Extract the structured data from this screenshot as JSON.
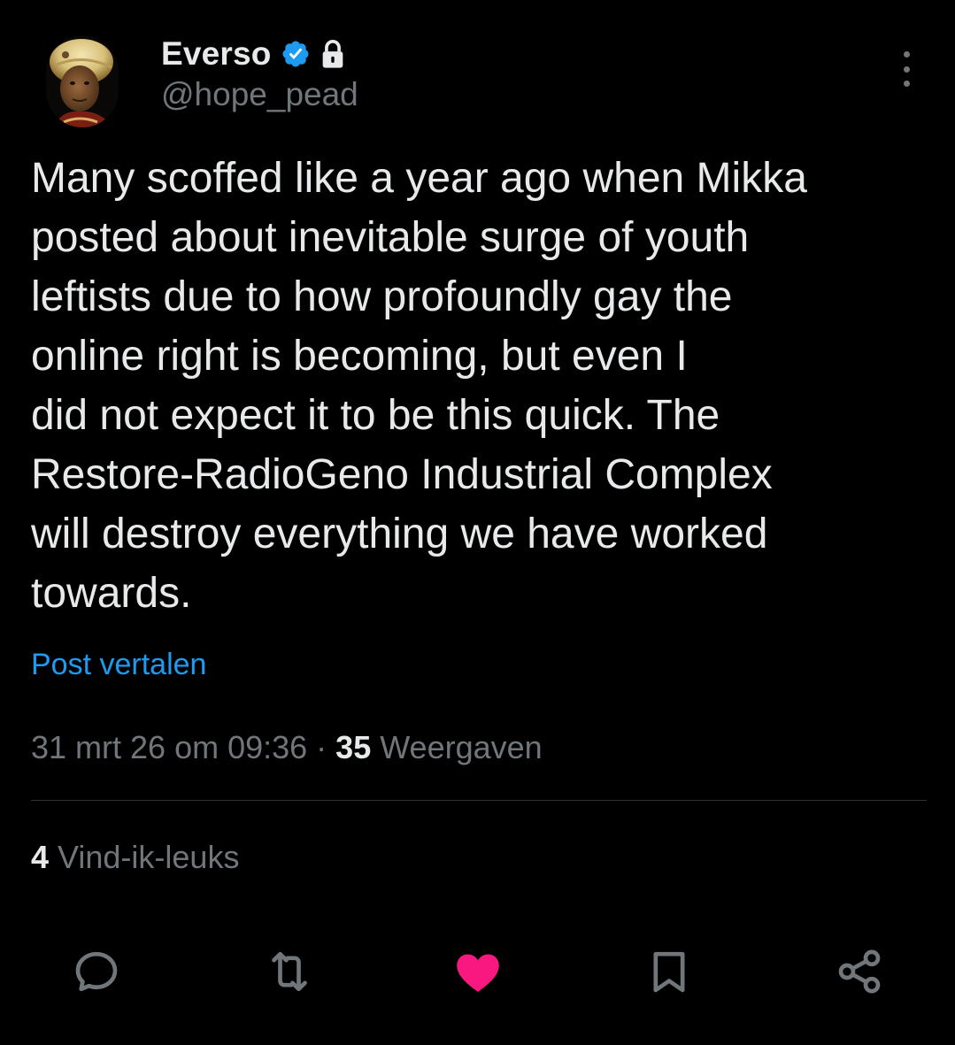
{
  "author": {
    "display_name": "Everso",
    "handle": "@hope_pead",
    "avatar_icon": "avatar-portrait",
    "badges": [
      "verified-badge-icon",
      "lock-icon"
    ]
  },
  "post": {
    "text": "Many scoffed like a year ago when Mikka\nposted about inevitable surge of youth\nleftists due to how profoundly gay the\nonline right is becoming, but even I\ndid not expect it to be this quick. The\nRestore-RadioGeno Industrial Complex\nwill destroy everything we have worked\ntowards.",
    "translate_label": "Post vertalen",
    "timestamp": "31 mrt 26 om 09:36",
    "separator": " · ",
    "views_count": "35",
    "views_label": " Weergaven",
    "likes_count": "4",
    "likes_label": " Vind-ik-leuks"
  },
  "actions": [
    "reply-icon",
    "repost-icon",
    "like-icon",
    "bookmark-icon",
    "share-icon"
  ],
  "colors": {
    "background": "#000000",
    "text": "#e7e9ea",
    "secondary": "#71767b",
    "link": "#1d9bf0",
    "like": "#f91880",
    "verified": "#1d9bf0"
  }
}
